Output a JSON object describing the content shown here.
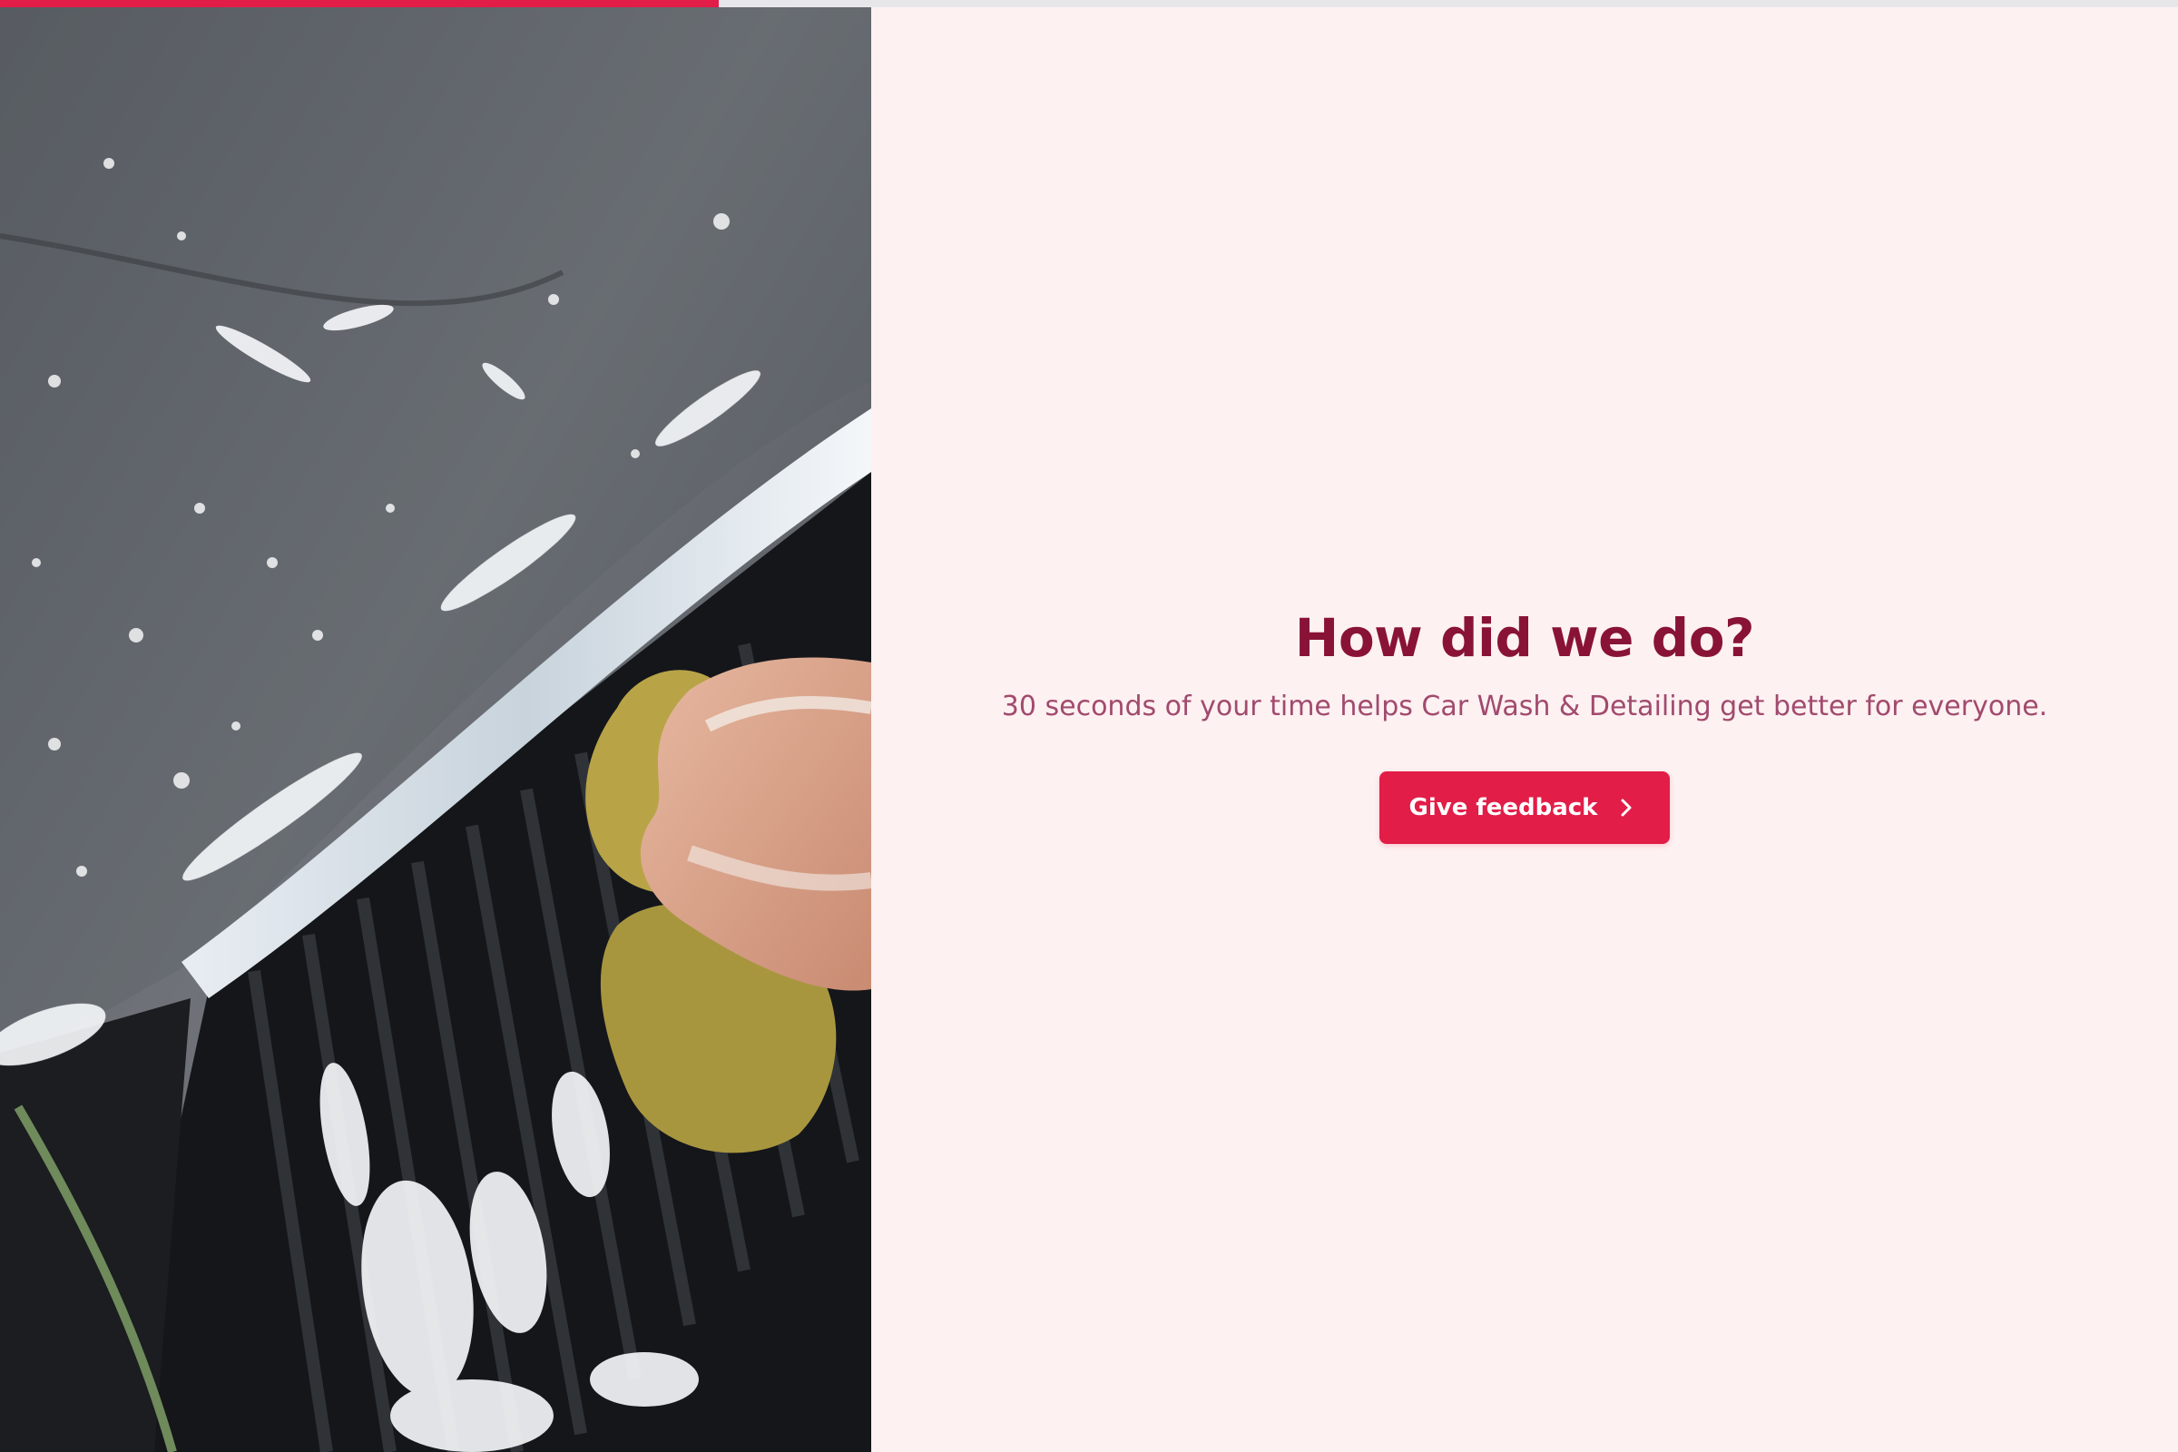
{
  "progress": {
    "fraction": 0.33,
    "fill_color": "#e11d48",
    "track_color": "#e7e7ea"
  },
  "hero_image": {
    "subject": "hand washing a car grille with a soapy sponge"
  },
  "content": {
    "title": "How did we do?",
    "subtitle": "30 seconds of your time helps Car Wash & Detailing get better for everyone.",
    "button_label": "Give feedback",
    "button_icon": "chevron-right-icon"
  },
  "colors": {
    "background": "#fdf1f1",
    "title": "#881337",
    "subtitle": "#a14a6e",
    "accent": "#e11d48"
  }
}
